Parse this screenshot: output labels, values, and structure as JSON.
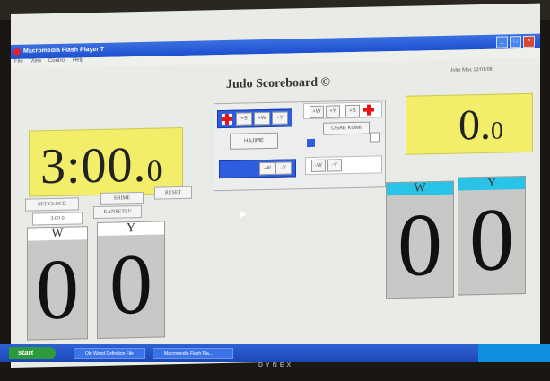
{
  "window": {
    "title": "Macromedia Flash Player 7",
    "menu": [
      "File",
      "View",
      "Control",
      "Help"
    ]
  },
  "scoreboard": {
    "title": "Judo Scoreboard ©",
    "meta": "John Max   12/01/08"
  },
  "main_clock": {
    "value": "3:00.",
    "fraction": "0"
  },
  "osaekomi_clock": {
    "value": "0.",
    "fraction": "0"
  },
  "controls": {
    "set_clock": "SET CLOCK",
    "shime": "SHIME",
    "reset": "RESET",
    "clock_input": "3:00 0",
    "kansetsu": "KANSETSU",
    "hajime": "HAJIME",
    "osae_komi": "OSAE KOMI"
  },
  "left_panel": {
    "top_buttons": [
      "+S",
      "+W",
      "+Y"
    ],
    "bottom_buttons": [
      "-W",
      "-Y"
    ]
  },
  "right_panel": {
    "top_buttons": [
      "+W",
      "+Y",
      "+S"
    ],
    "bottom_buttons": [
      "-W",
      "-Y"
    ]
  },
  "left_scores": [
    {
      "label": "W",
      "value": "0"
    },
    {
      "label": "Y",
      "value": "0"
    }
  ],
  "right_scores": [
    {
      "label": "W",
      "value": "0"
    },
    {
      "label": "Y",
      "value": "0"
    }
  ],
  "taskbar": {
    "start": "start",
    "tasks": [
      "Old Wood Definition File",
      "Macromedia Flash Pla..."
    ]
  },
  "monitor_brand": "DYNEX",
  "colors": {
    "clock_bg": "#f2ee69",
    "blue_team": "#2f5de0",
    "blue_header": "#29c3e8",
    "penalty_cross": "#e11111"
  }
}
